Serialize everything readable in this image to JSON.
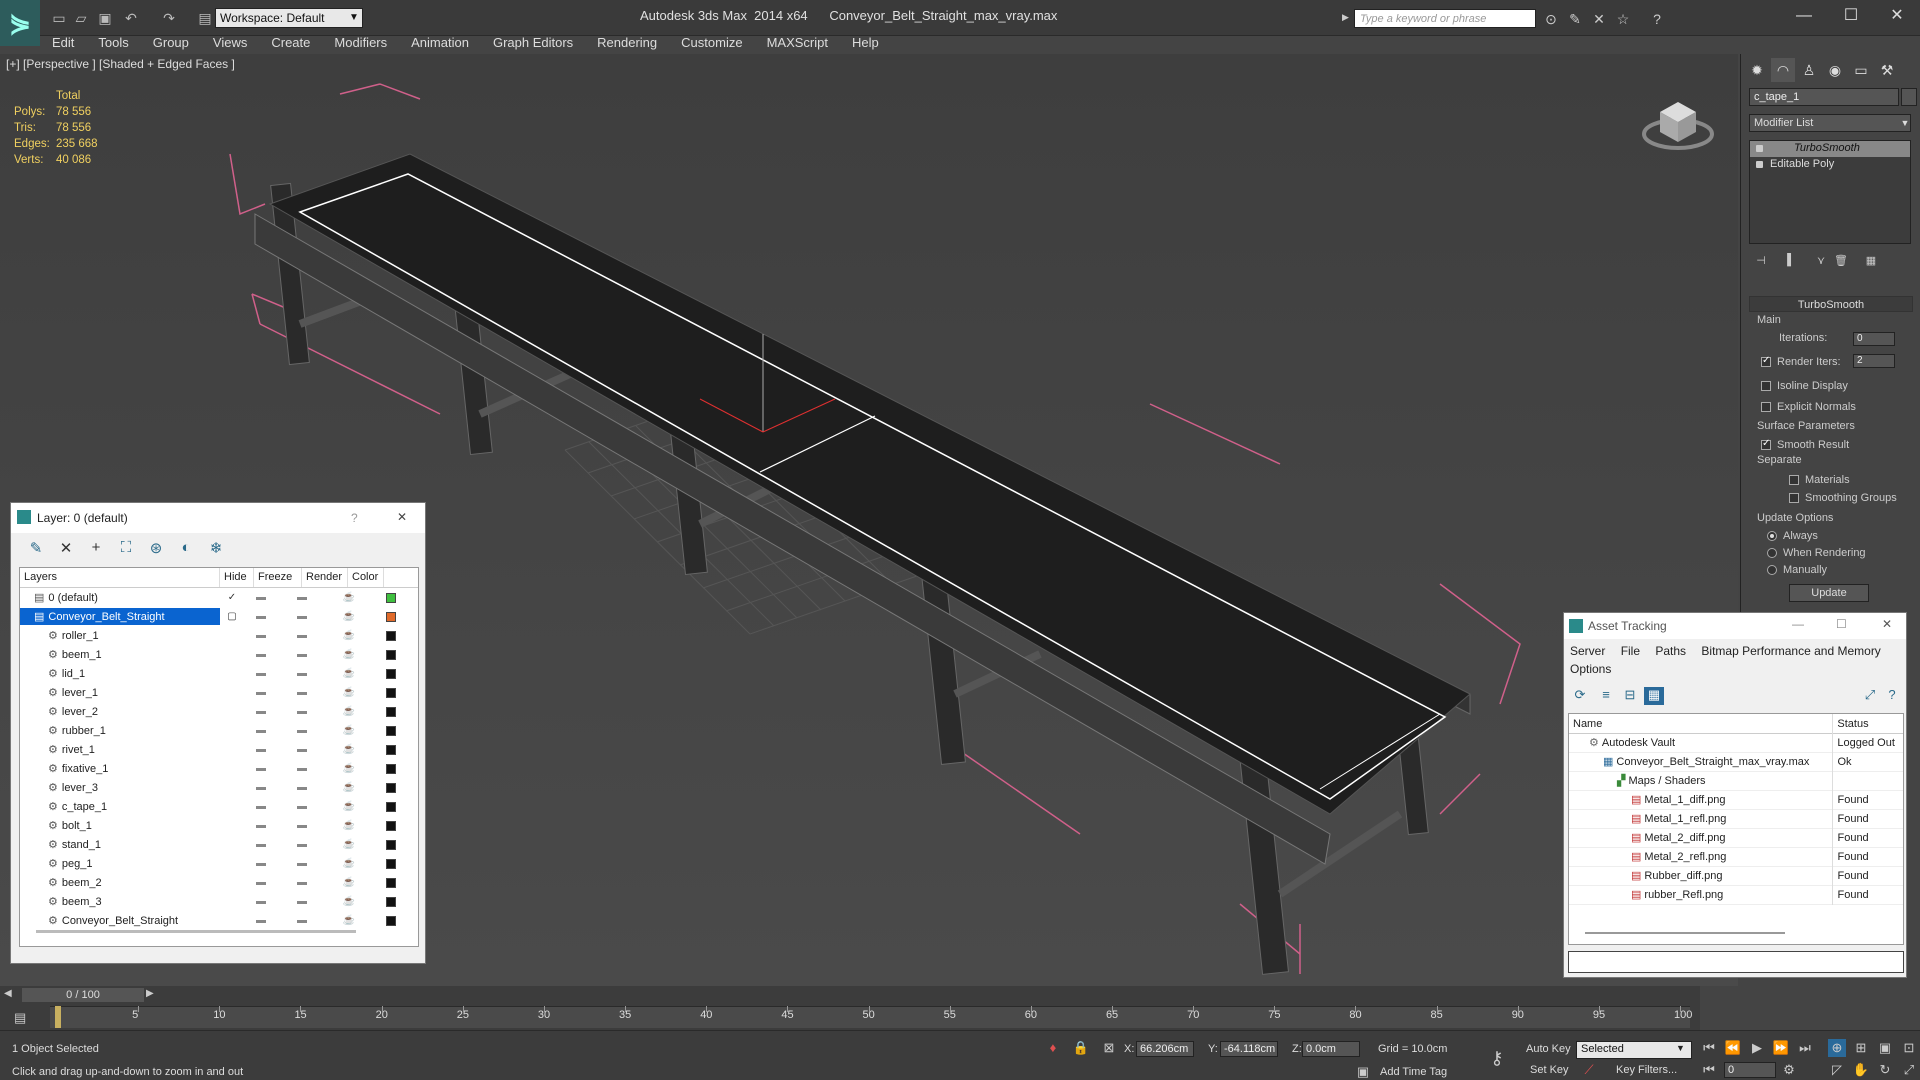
{
  "app": {
    "title": "Autodesk 3ds Max  2014 x64      Conveyor_Belt_Straight_max_vray.max",
    "workspace": "Workspace: Default",
    "search_placeholder": "Type a keyword or phrase"
  },
  "menu": [
    "Edit",
    "Tools",
    "Group",
    "Views",
    "Create",
    "Modifiers",
    "Animation",
    "Graph Editors",
    "Rendering",
    "Customize",
    "MAXScript",
    "Help"
  ],
  "viewport": {
    "label": "[+] [Perspective ] [Shaded + Edged Faces ]",
    "stats": {
      "header": "Total",
      "rows": [
        {
          "label": "Polys:",
          "value": "78 556"
        },
        {
          "label": "Tris:",
          "value": "78 556"
        },
        {
          "label": "Edges:",
          "value": "235 668"
        },
        {
          "label": "Verts:",
          "value": "40 086"
        }
      ]
    }
  },
  "command_panel": {
    "object_name": "c_tape_1",
    "modifier_list": "Modifier List",
    "stack": [
      "TurboSmooth",
      "Editable Poly"
    ],
    "turbosmooth": {
      "title": "TurboSmooth",
      "main": "Main",
      "iterations_label": "Iterations:",
      "iterations": "0",
      "render_iters_label": "Render Iters:",
      "render_iters": "2",
      "render_iters_on": true,
      "isoline": "Isoline Display",
      "explicit_normals": "Explicit Normals",
      "surface_params": "Surface Parameters",
      "smooth_result": "Smooth Result",
      "separate": "Separate",
      "materials": "Materials",
      "smoothing_groups": "Smoothing Groups",
      "update_options": "Update Options",
      "always": "Always",
      "when_rendering": "When Rendering",
      "manually": "Manually",
      "update_button": "Update"
    }
  },
  "layer_dialog": {
    "title": "Layer: 0 (default)",
    "help": "?",
    "close": "✕",
    "columns": [
      "Layers",
      "Hide",
      "Freeze",
      "Render",
      "Color"
    ],
    "rows": [
      {
        "name": "0 (default)",
        "indent": 1,
        "color": "#3fbf3f",
        "check": "✓",
        "selected": false
      },
      {
        "name": "Conveyor_Belt_Straight",
        "indent": 1,
        "color": "#e06a2a",
        "check": "▢",
        "selected": true
      },
      {
        "name": "roller_1",
        "indent": 2,
        "color": "#111111"
      },
      {
        "name": "beem_1",
        "indent": 2,
        "color": "#111111"
      },
      {
        "name": "lid_1",
        "indent": 2,
        "color": "#111111"
      },
      {
        "name": "lever_1",
        "indent": 2,
        "color": "#111111"
      },
      {
        "name": "lever_2",
        "indent": 2,
        "color": "#111111"
      },
      {
        "name": "rubber_1",
        "indent": 2,
        "color": "#111111"
      },
      {
        "name": "rivet_1",
        "indent": 2,
        "color": "#111111"
      },
      {
        "name": "fixative_1",
        "indent": 2,
        "color": "#111111"
      },
      {
        "name": "lever_3",
        "indent": 2,
        "color": "#111111"
      },
      {
        "name": "c_tape_1",
        "indent": 2,
        "color": "#111111"
      },
      {
        "name": "bolt_1",
        "indent": 2,
        "color": "#111111"
      },
      {
        "name": "stand_1",
        "indent": 2,
        "color": "#111111"
      },
      {
        "name": "peg_1",
        "indent": 2,
        "color": "#111111"
      },
      {
        "name": "beem_2",
        "indent": 2,
        "color": "#111111"
      },
      {
        "name": "beem_3",
        "indent": 2,
        "color": "#111111"
      },
      {
        "name": "Conveyor_Belt_Straight",
        "indent": 2,
        "color": "#111111"
      }
    ]
  },
  "asset_dialog": {
    "title": "Asset Tracking",
    "menu": [
      "Server",
      "File",
      "Paths",
      "Bitmap Performance and Memory",
      "Options"
    ],
    "columns": [
      "Name",
      "Status"
    ],
    "rows": [
      {
        "name": "Autodesk Vault",
        "status": "Logged Out",
        "indent": 1
      },
      {
        "name": "Conveyor_Belt_Straight_max_vray.max",
        "status": "Ok",
        "indent": 2
      },
      {
        "name": "Maps / Shaders",
        "status": "",
        "indent": 3
      },
      {
        "name": "Metal_1_diff.png",
        "status": "Found",
        "indent": 4
      },
      {
        "name": "Metal_1_refl.png",
        "status": "Found",
        "indent": 4
      },
      {
        "name": "Metal_2_diff.png",
        "status": "Found",
        "indent": 4
      },
      {
        "name": "Metal_2_refl.png",
        "status": "Found",
        "indent": 4
      },
      {
        "name": "Rubber_diff.png",
        "status": "Found",
        "indent": 4
      },
      {
        "name": "rubber_Refl.png",
        "status": "Found",
        "indent": 4
      }
    ]
  },
  "timeline": {
    "slider": "0 / 100",
    "ticks": [
      5,
      10,
      15,
      20,
      25,
      30,
      35,
      40,
      45,
      50,
      55,
      60,
      65,
      70,
      75,
      80,
      85,
      90,
      95,
      100
    ]
  },
  "status": {
    "selection": "1 Object Selected",
    "prompt": "Click and drag up-and-down to zoom in and out",
    "x_label": "X:",
    "x": "66.206cm",
    "y_label": "Y:",
    "y": "-64.118cm",
    "z_label": "Z:",
    "z": "0.0cm",
    "grid": "Grid = 10.0cm",
    "add_time_tag": "Add Time Tag",
    "auto_key": "Auto Key",
    "set_key": "Set Key",
    "selected": "Selected",
    "key_filters": "Key Filters...",
    "frame": "0"
  }
}
